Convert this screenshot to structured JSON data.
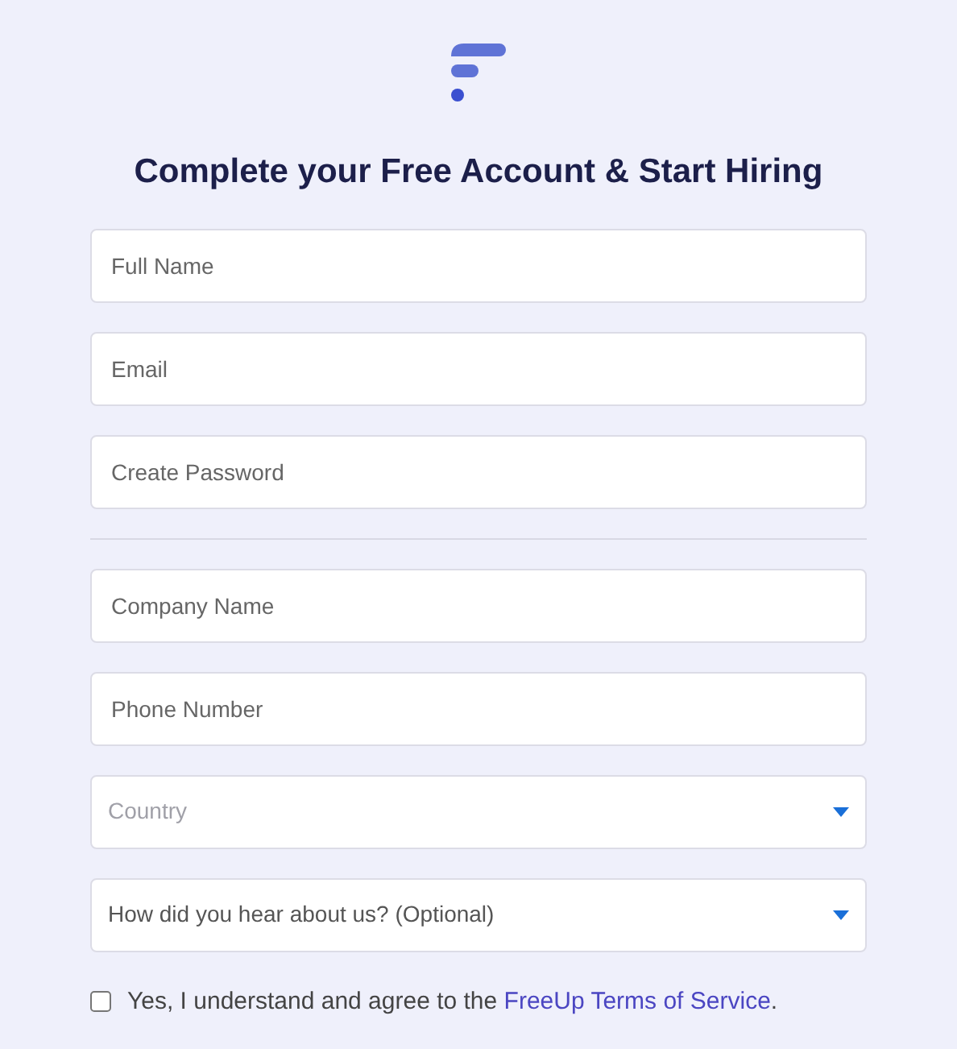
{
  "title": "Complete your Free Account & Start Hiring",
  "account_fields": [
    {
      "placeholder": "Full Name"
    },
    {
      "placeholder": "Email"
    },
    {
      "placeholder": "Create Password"
    }
  ],
  "company_fields": [
    {
      "kind": "text",
      "placeholder": "Company Name"
    },
    {
      "kind": "text",
      "placeholder": "Phone Number"
    },
    {
      "kind": "select",
      "placeholder": "Country"
    },
    {
      "kind": "select",
      "value": "How did you hear about us? (Optional)"
    }
  ],
  "agreement": {
    "checked": false,
    "text": "Yes, I understand and agree to the ",
    "link": "FreeUp Terms of Service",
    "after": "."
  }
}
